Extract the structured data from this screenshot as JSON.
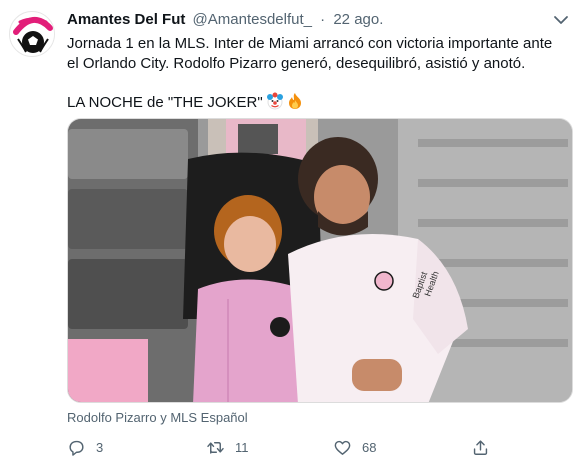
{
  "author": {
    "name": "Amantes Del Fut",
    "handle": "@Amantesdelfut_",
    "separator": "·",
    "timestamp": "22 ago."
  },
  "tweet": {
    "line1": "Jornada 1 en la MLS. Inter de Miami arrancó con victoria importante ante",
    "line2": "el Orlando City. Rodolfo Pizarro generó, desequilibró, asistió y anotó.",
    "line3": "LA NOCHE de \"THE JOKER\"",
    "emojis": [
      "clown-face",
      "fire"
    ]
  },
  "media": {
    "type": "photo",
    "jersey_text_1": "Baptist",
    "jersey_text_2": "Health"
  },
  "tagged": "Rodolfo Pizarro y MLS Español",
  "actions": {
    "reply_count": "3",
    "retweet_count": "11",
    "like_count": "68"
  },
  "colors": {
    "accent_pink": "#e21e79",
    "text_primary": "#0f1419",
    "text_secondary": "#536471"
  }
}
